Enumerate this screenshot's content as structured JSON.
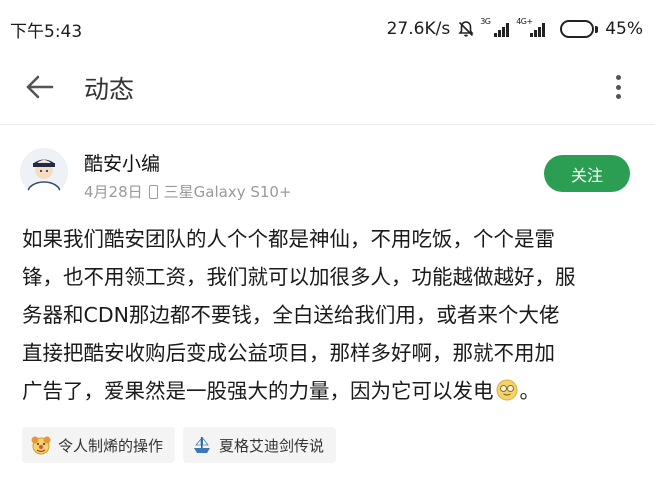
{
  "status_bar": {
    "time": "下午5:43",
    "net_speed": "27.6K/s",
    "sim1_type": "3G",
    "sim2_type": "4G+",
    "battery": "45%",
    "battery_level": 0.45
  },
  "app_bar": {
    "title": "动态",
    "back_icon": "arrow-left-icon",
    "more_icon": "more-vertical-icon"
  },
  "post": {
    "author": "酷安小编",
    "date": "4月28日",
    "device": "三星Galaxy S10+",
    "follow_label": "关注",
    "lines": [
      "如果我们酷安团队的人个个都是神仙，不用吃饭，个个是雷",
      "锋，也不用领工资，我们就可以加很多人，功能越做越好，服",
      "务器和CDN那边都不要钱，全白送给我们用，或者来个大佬",
      "直接把酷安收购后变成公益项目，那样多好啊，那就不用加"
    ],
    "last_line_before_emoji": "广告了，爱果然是一股强大的力量，因为它可以发电",
    "last_line_after_emoji": "。",
    "emoji": "nerd-face-emoji-icon"
  },
  "tags": [
    {
      "label": "令人制烯的操作",
      "icon": "clown-emoji-icon"
    },
    {
      "label": "夏格艾迪剑传说",
      "icon": "ship-icon"
    }
  ],
  "colors": {
    "accent": "#2c9e53",
    "meta_gray": "#9a9a9a",
    "tag_bg": "#f4f4f4"
  }
}
